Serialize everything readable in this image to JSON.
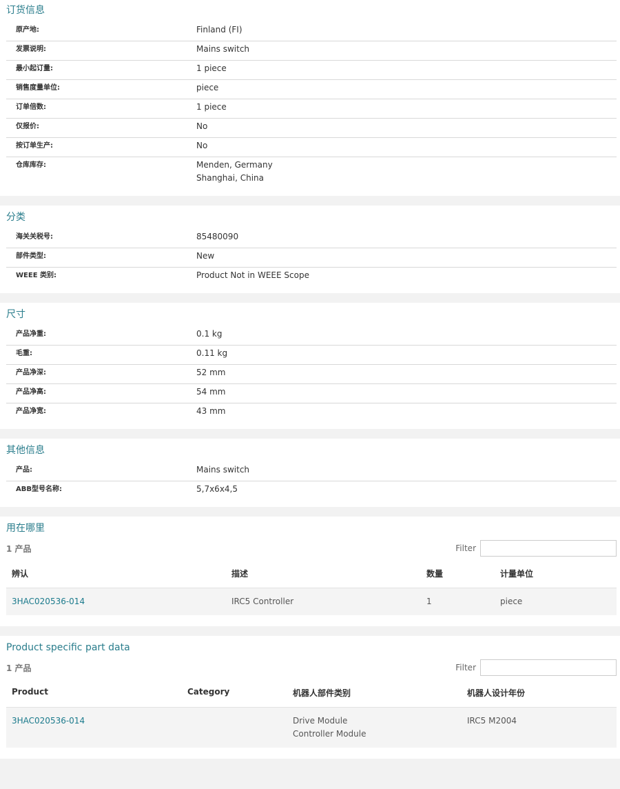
{
  "order_info": {
    "title": "订货信息",
    "rows": [
      {
        "label": "原产地:",
        "values": [
          "Finland (FI)"
        ]
      },
      {
        "label": "发票说明:",
        "values": [
          "Mains switch"
        ]
      },
      {
        "label": "最小起订量:",
        "values": [
          "1 piece"
        ]
      },
      {
        "label": "销售度量单位:",
        "values": [
          "piece"
        ]
      },
      {
        "label": "订单倍数:",
        "values": [
          "1 piece"
        ]
      },
      {
        "label": "仅报价:",
        "values": [
          "No"
        ]
      },
      {
        "label": "按订单生产:",
        "values": [
          "No"
        ]
      },
      {
        "label": "仓库库存:",
        "values": [
          "Menden, Germany",
          "Shanghai, China"
        ]
      }
    ]
  },
  "classification": {
    "title": "分类",
    "rows": [
      {
        "label": "海关关税号:",
        "values": [
          "85480090"
        ]
      },
      {
        "label": "部件类型:",
        "values": [
          "New"
        ]
      },
      {
        "label": "WEEE 类别:",
        "values": [
          "Product Not in WEEE Scope"
        ]
      }
    ]
  },
  "dimensions": {
    "title": "尺寸",
    "rows": [
      {
        "label": "产品净重:",
        "values": [
          "0.1 kg"
        ]
      },
      {
        "label": "毛重:",
        "values": [
          "0.11 kg"
        ]
      },
      {
        "label": "产品净深:",
        "values": [
          "52 mm"
        ]
      },
      {
        "label": "产品净高:",
        "values": [
          "54 mm"
        ]
      },
      {
        "label": "产品净宽:",
        "values": [
          "43 mm"
        ]
      }
    ]
  },
  "other_info": {
    "title": "其他信息",
    "rows": [
      {
        "label": "产品:",
        "values": [
          "Mains switch"
        ]
      },
      {
        "label": "ABB型号名称:",
        "values": [
          "5,7x6x4,5"
        ]
      }
    ]
  },
  "where_used": {
    "title": "用在哪里",
    "count": "1 产品",
    "filter_label": "Filter",
    "headers": [
      "辨认",
      "描述",
      "数量",
      "计量单位"
    ],
    "rows": [
      {
        "id": "3HAC020536-014",
        "desc": "IRC5 Controller",
        "qty": "1",
        "unit": "piece"
      }
    ]
  },
  "part_data": {
    "title": "Product specific part data",
    "count": "1 产品",
    "filter_label": "Filter",
    "headers": [
      "Product",
      "Category",
      "机器人部件类别",
      "机器人设计年份"
    ],
    "rows": [
      {
        "product": "3HAC020536-014",
        "category": "",
        "robot_part": [
          "Drive Module",
          "Controller Module"
        ],
        "design_year": "IRC5 M2004"
      }
    ]
  }
}
